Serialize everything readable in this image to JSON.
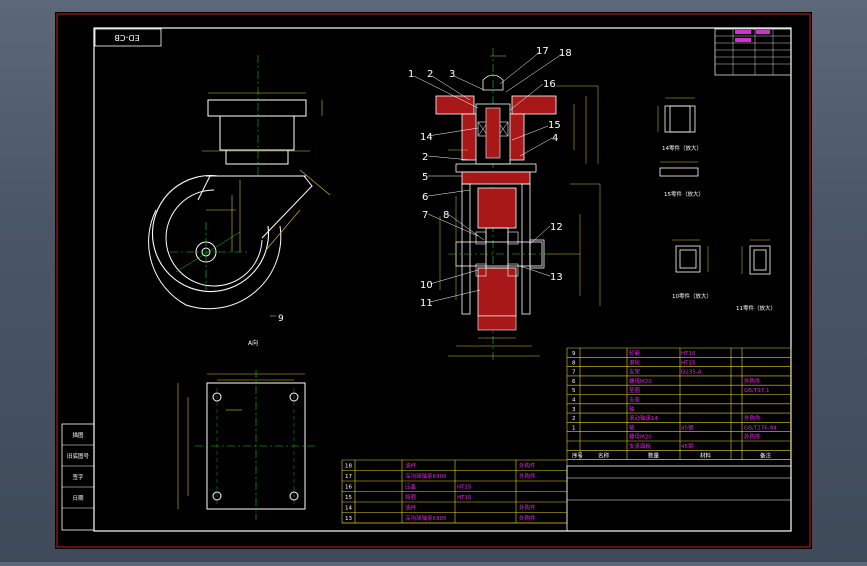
{
  "colors": {
    "background": "#000000",
    "frame": "#c81e1e",
    "outline": "#ffffff",
    "centerline": "#12d012",
    "dimension": "#e0c020",
    "hatch": "#c02020",
    "table_line": "#e8d020",
    "table_text": "#e020e0"
  },
  "drawing": {
    "drawing_number": "ED-CB"
  },
  "views": {
    "side_view_label": "A向",
    "balloons": [
      "1",
      "2",
      "3",
      "17",
      "18",
      "16",
      "14",
      "15",
      "4",
      "2",
      "5",
      "6",
      "7",
      "8",
      "12",
      "10",
      "13",
      "11",
      "9"
    ]
  },
  "detail_labels": {
    "d14": "14零件（放大）",
    "d15": "15零件（放大）",
    "d10": "10零件（放大）",
    "d11": "11零件（放大）"
  },
  "parts_list": {
    "rows": [
      {
        "no": "9",
        "name": "轮毂",
        "material": "HT15",
        "note": ""
      },
      {
        "no": "8",
        "name": "滚轮",
        "material": "HT15",
        "note": ""
      },
      {
        "no": "7",
        "name": "支架",
        "material": "Q235-A",
        "note": ""
      },
      {
        "no": "6",
        "name": "螺母M20",
        "material": "",
        "note": "外购件"
      },
      {
        "no": "5",
        "name": "垫圈",
        "material": "",
        "note": "GB/T97.1"
      },
      {
        "no": "4",
        "name": "支座",
        "material": "",
        "note": ""
      },
      {
        "no": "3",
        "name": "轴",
        "material": "",
        "note": ""
      },
      {
        "no": "2",
        "name": "滚动轴承14",
        "material": "",
        "note": "外购件"
      },
      {
        "no": "1",
        "name": "轴",
        "material": "45钢",
        "note": "GB/T276-94"
      },
      {
        "no": "",
        "name": "螺母M20",
        "material": "",
        "note": "外购件"
      },
      {
        "no": "",
        "name": "支承面板",
        "material": "45钢",
        "note": ""
      }
    ],
    "header": {
      "no": "序号",
      "name": "名称",
      "qty": "数量",
      "material": "材料",
      "note": "备注"
    }
  },
  "parts_list_2": {
    "rows": [
      {
        "no": "18",
        "name": "油杯",
        "note": "外购件"
      },
      {
        "no": "17",
        "name": "深沟球轴承6306",
        "note": "外购件"
      },
      {
        "no": "16",
        "name": "压盖",
        "material": "HT15",
        "note": ""
      },
      {
        "no": "15",
        "name": "挡圈",
        "material": "HT15",
        "note": ""
      },
      {
        "no": "14",
        "name": "油杯",
        "note": "外购件"
      },
      {
        "no": "13",
        "name": "深沟球轴承6305",
        "note": "外购件"
      }
    ]
  },
  "left_stamp": {
    "items": [
      "描图",
      "旧底图号",
      "签字",
      "日期"
    ]
  }
}
